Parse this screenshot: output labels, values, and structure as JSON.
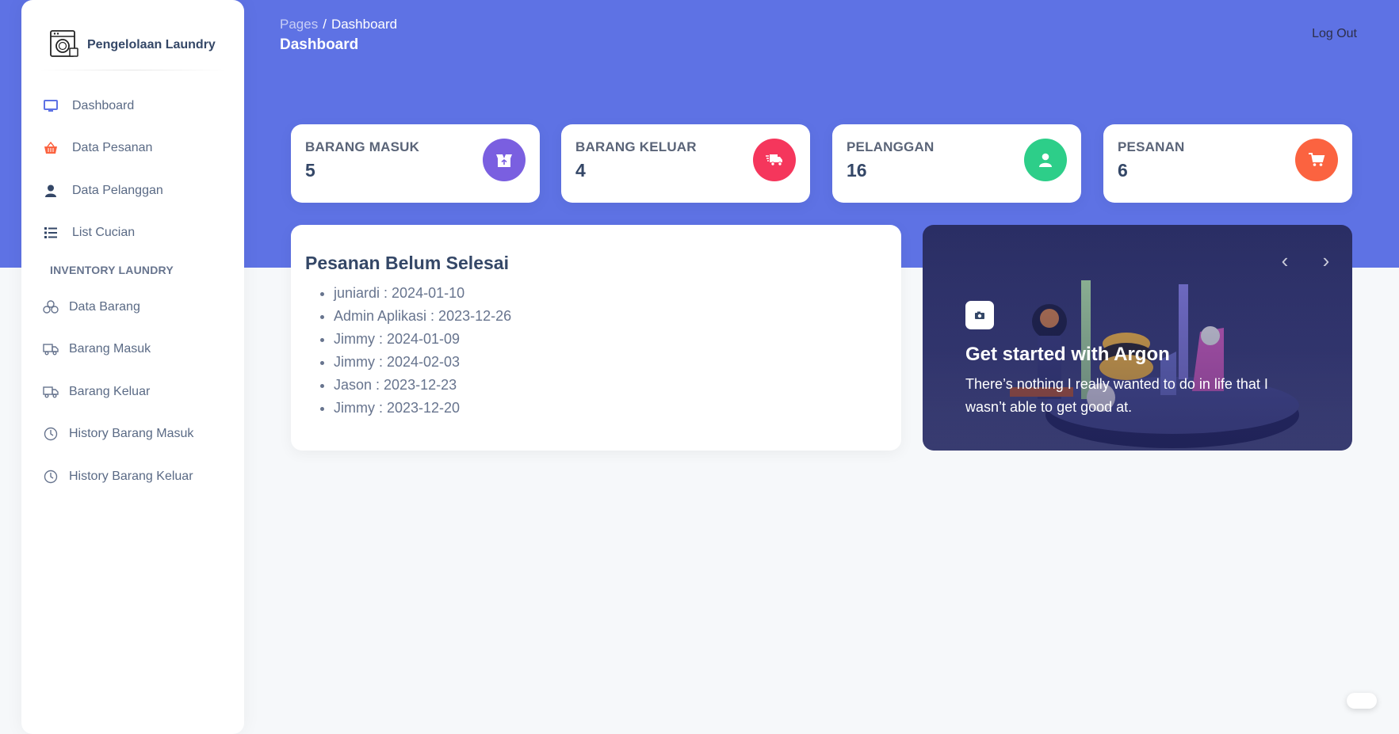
{
  "brand": {
    "title": "Pengelolaan Laundry",
    "icon": "washing-machine-icon"
  },
  "breadcrumb": {
    "root": "Pages",
    "separator": "/",
    "current": "Dashboard"
  },
  "header": {
    "title": "Dashboard",
    "logout_label": "Log Out"
  },
  "sidebar": {
    "items": [
      {
        "label": "Dashboard",
        "icon": "monitor-icon",
        "color": "#5e72e4"
      },
      {
        "label": "Data Pesanan",
        "icon": "basket-icon",
        "color": "#fb6340"
      },
      {
        "label": "Data Pelanggan",
        "icon": "user-icon",
        "color": "#344767"
      },
      {
        "label": "List Cucian",
        "icon": "list-icon",
        "color": "#344767"
      }
    ],
    "section_title": "INVENTORY LAUNDRY",
    "inventory_items": [
      {
        "label": "Data Barang",
        "icon": "boxes-icon"
      },
      {
        "label": "Barang Masuk",
        "icon": "truck-icon"
      },
      {
        "label": "Barang Keluar",
        "icon": "truck-icon"
      },
      {
        "label": "History Barang Masuk",
        "icon": "clock-icon"
      },
      {
        "label": "History Barang Keluar",
        "icon": "clock-icon"
      }
    ]
  },
  "stats": [
    {
      "label": "BARANG MASUK",
      "value": "5",
      "icon": "box-open-icon",
      "color": "#7a5fe0"
    },
    {
      "label": "BARANG KELUAR",
      "value": "4",
      "icon": "delivery-truck-icon",
      "color": "#f5365c"
    },
    {
      "label": "PELANGGAN",
      "value": "16",
      "icon": "user-icon",
      "color": "#2dce89"
    },
    {
      "label": "PESANAN",
      "value": "6",
      "icon": "cart-icon",
      "color": "#fb6340"
    }
  ],
  "orders": {
    "title": "Pesanan Belum Selesai",
    "items": [
      "juniardi : 2024-01-10",
      "Admin Aplikasi : 2023-12-26",
      "Jimmy : 2024-01-09",
      "Jimmy : 2024-02-03",
      "Jason : 2023-12-23",
      "Jimmy : 2023-12-20"
    ]
  },
  "carousel": {
    "title": "Get started with Argon",
    "text": "There’s nothing I really wanted to do in life that I wasn’t able to get good at.",
    "icon": "camera-icon"
  },
  "colors": {
    "primary": "#5e72e4",
    "background": "#f6f8fa"
  }
}
